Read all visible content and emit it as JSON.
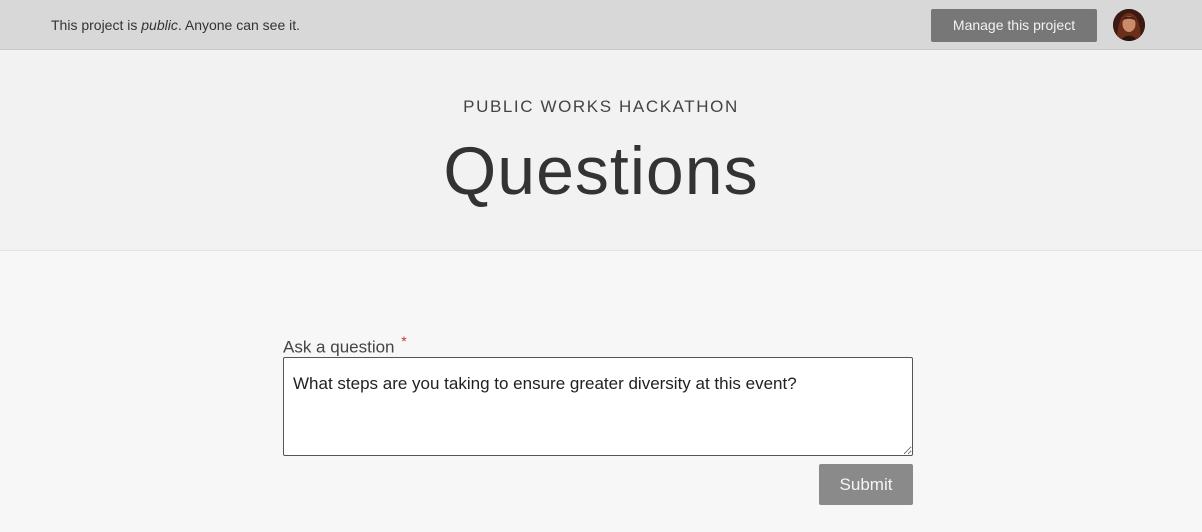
{
  "topbar": {
    "visibility_prefix": "This project is ",
    "visibility_word": "public",
    "visibility_suffix": ". Anyone can see it.",
    "manage_label": "Manage this project",
    "avatar_icon": "user-avatar-icon"
  },
  "hero": {
    "project_name": "PUBLIC WORKS HACKATHON",
    "title": "Questions"
  },
  "form": {
    "label": "Ask a question",
    "required_mark": "*",
    "question_value": "What steps are you taking to ensure greater diversity at this event?",
    "submit_label": "Submit"
  },
  "colors": {
    "topbar_bg": "#d8d8d8",
    "button_bg": "#777777",
    "submit_bg": "#8a8a8a",
    "required": "#c0392b"
  }
}
